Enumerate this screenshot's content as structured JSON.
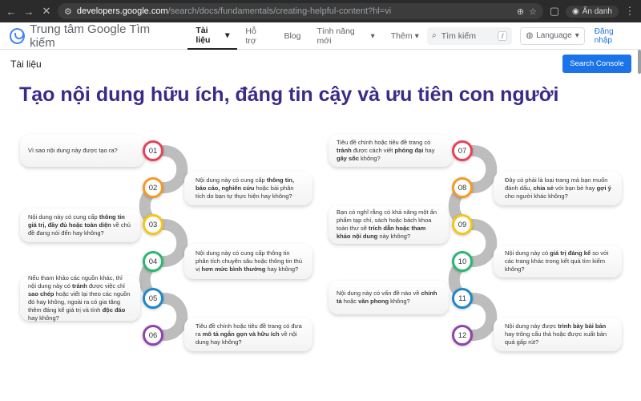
{
  "browser": {
    "url_domain": "developers.google.com",
    "url_path": "/search/docs/fundamentals/creating-helpful-content?hl=vi",
    "incognito_label": "Ẩn danh"
  },
  "nav": {
    "logo_text": "Trung tâm Google Tìm kiếm",
    "items": [
      {
        "label": "Tài liệu"
      },
      {
        "label": "Hỗ trợ"
      },
      {
        "label": "Blog"
      },
      {
        "label": "Tính năng mới"
      },
      {
        "label": "Thêm"
      }
    ],
    "search_placeholder": "Tìm kiếm",
    "search_shortcut": "/",
    "language_label": "Language",
    "login_label": "Đăng nhập"
  },
  "page": {
    "breadcrumb": "Tài liệu",
    "search_console_button": "Search Console",
    "title": "Tạo nội dung hữu ích, đáng tin cậy và ưu tiên con người"
  },
  "colors": {
    "c01": "#e8425a",
    "c02": "#f59a23",
    "c03": "#f5c518",
    "c04": "#2bb673",
    "c05": "#1e88c9",
    "c06": "#8e44ad"
  },
  "questions": [
    {
      "num": "01",
      "html": "Vì sao nội dung này được tạo ra?"
    },
    {
      "num": "02",
      "html": "Nội dung này có cung cấp <b>thông tin, báo cáo, nghiên cứu</b> hoặc bài phân tích do bạn tự thực hiện hay không?"
    },
    {
      "num": "03",
      "html": "Nội dung này có cung cấp <b>thông tin giá trị, đầy đủ hoặc toàn diện</b> về chủ đề đang nói đến hay không?"
    },
    {
      "num": "04",
      "html": "Nội dung này có cung cấp thông tin phân tích chuyên sâu hoặc thông tin thú vị <b>hơn mức bình thường</b> hay không?"
    },
    {
      "num": "05",
      "html": "Nếu tham khảo các nguồn khác, thì nội dung này có <b>tránh</b> được việc chỉ <b>sao chép</b> hoặc viết lại theo các nguồn đó hay không, ngoài ra có gia tăng thêm đáng kể giá trị và tính <b>độc đáo</b> hay không?"
    },
    {
      "num": "06",
      "html": "Tiêu đề chính hoặc tiêu đề trang có đưa ra <b>mô tả ngắn gọn và hữu ích</b> về nội dung hay không?"
    },
    {
      "num": "07",
      "html": "Tiêu đề chính hoặc tiêu đề trang có <b>tránh</b> được cách viết <b>phóng đại</b> hay <b>gây sốc</b> không?"
    },
    {
      "num": "08",
      "html": "Đây có phải là loại trang mà bạn muốn đánh dấu, <b>chia sẻ</b> với bạn bè hay <b>gợi ý</b> cho người khác không?"
    },
    {
      "num": "09",
      "html": "Bạn có nghĩ rằng có khả năng một ấn phẩm tạp chí, sách hoặc bách khoa toàn thư sẽ <b>trích dẫn hoặc tham khảo nội dung</b> này không?"
    },
    {
      "num": "10",
      "html": "Nội dung này có <b>giá trị đáng kể</b> so với các trang khác trong kết quả tìm kiếm không?"
    },
    {
      "num": "11",
      "html": "Nội dung này có vấn đề nào về <b>chính tả</b> hoặc <b>văn phong</b> không?"
    },
    {
      "num": "12",
      "html": "Nội dung này được <b>trình bày bài bản</b> hay trông cẩu thả hoặc được xuất bản quá gấp rút?"
    }
  ]
}
